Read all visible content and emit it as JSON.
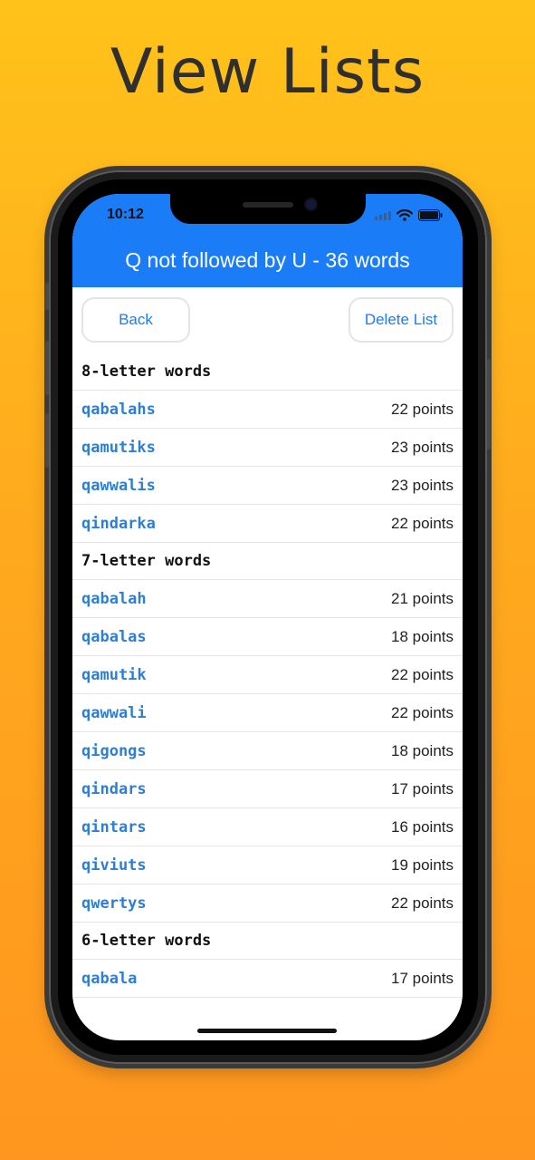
{
  "promo": {
    "title": "View Lists"
  },
  "status_bar": {
    "time": "10:12"
  },
  "header": {
    "title": "Q not followed by U - 36 words"
  },
  "buttons": {
    "back": "Back",
    "delete": "Delete List"
  },
  "sections": [
    {
      "title": "8-letter words",
      "rows": [
        {
          "word": "qabalahs",
          "points": "22 points"
        },
        {
          "word": "qamutiks",
          "points": "23 points"
        },
        {
          "word": "qawwalis",
          "points": "23 points"
        },
        {
          "word": "qindarka",
          "points": "22 points"
        }
      ]
    },
    {
      "title": "7-letter words",
      "rows": [
        {
          "word": "qabalah",
          "points": "21 points"
        },
        {
          "word": "qabalas",
          "points": "18 points"
        },
        {
          "word": "qamutik",
          "points": "22 points"
        },
        {
          "word": "qawwali",
          "points": "22 points"
        },
        {
          "word": "qigongs",
          "points": "18 points"
        },
        {
          "word": "qindars",
          "points": "17 points"
        },
        {
          "word": "qintars",
          "points": "16 points"
        },
        {
          "word": "qiviuts",
          "points": "19 points"
        },
        {
          "word": "qwertys",
          "points": "22 points"
        }
      ]
    },
    {
      "title": "6-letter words",
      "rows": [
        {
          "word": "qabala",
          "points": "17 points"
        }
      ]
    }
  ],
  "colors": {
    "accent": "#1A7CF6",
    "word_link": "#2c7fd3"
  },
  "icons": [
    "signal-icon",
    "wifi-icon",
    "battery-icon"
  ]
}
